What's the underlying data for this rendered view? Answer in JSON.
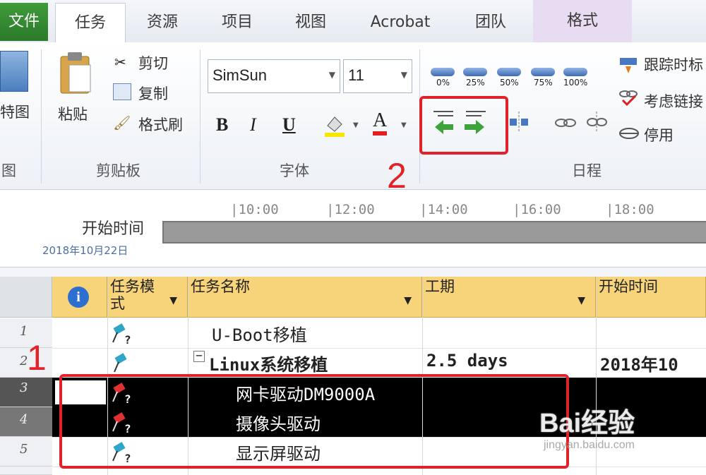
{
  "tabs": {
    "file": "文件",
    "task": "任务",
    "resource": "资源",
    "project": "项目",
    "view": "视图",
    "acrobat": "Acrobat",
    "team": "团队",
    "format": "格式"
  },
  "ribbon": {
    "view_group_partial": "特图",
    "view_group_label_partial": "图",
    "paste": "粘贴",
    "cut": "剪切",
    "copy": "复制",
    "format_painter": "格式刷",
    "clipboard_label": "剪贴板",
    "font_name": "SimSun",
    "font_size": "11",
    "bold": "B",
    "italic": "I",
    "underline": "U",
    "font_color_letter": "A",
    "font_label": "字体",
    "pct_0": "0%",
    "pct_25": "25%",
    "pct_50": "50%",
    "pct_75": "75%",
    "pct_100": "100%",
    "track_time": "跟踪时标",
    "respect_links": "考虑链接",
    "inactivate": "停用",
    "schedule_label": "日程"
  },
  "timeline": {
    "start_label": "开始时间",
    "start_date": "2018年10月22日",
    "ticks": [
      "10:00",
      "12:00",
      "14:00",
      "16:00",
      "18:00"
    ]
  },
  "grid": {
    "headers": {
      "info": "i",
      "mode": "任务模式",
      "name": "任务名称",
      "duration": "工期",
      "start": "开始时间"
    },
    "rows": [
      {
        "num": "1",
        "name": "U-Boot移植",
        "duration": "",
        "start": ""
      },
      {
        "num": "2",
        "name": "Linux系统移植",
        "duration": "2.5 days",
        "start": "2018年10"
      },
      {
        "num": "3",
        "name": "网卡驱动DM9000A",
        "duration": "",
        "start": ""
      },
      {
        "num": "4",
        "name": "摄像头驱动",
        "duration": "",
        "start": ""
      },
      {
        "num": "5",
        "name": "显示屏驱动",
        "duration": "",
        "start": ""
      }
    ]
  },
  "annotations": {
    "one": "1",
    "two": "2"
  },
  "watermark": {
    "brand": "Bai经验",
    "url": "jingyan.baidu.com"
  },
  "colors": {
    "header_fill": "#f7d37a",
    "selected_row": "#000000",
    "annotation_red": "#e2222a",
    "file_tab": "#2c7a2a"
  }
}
